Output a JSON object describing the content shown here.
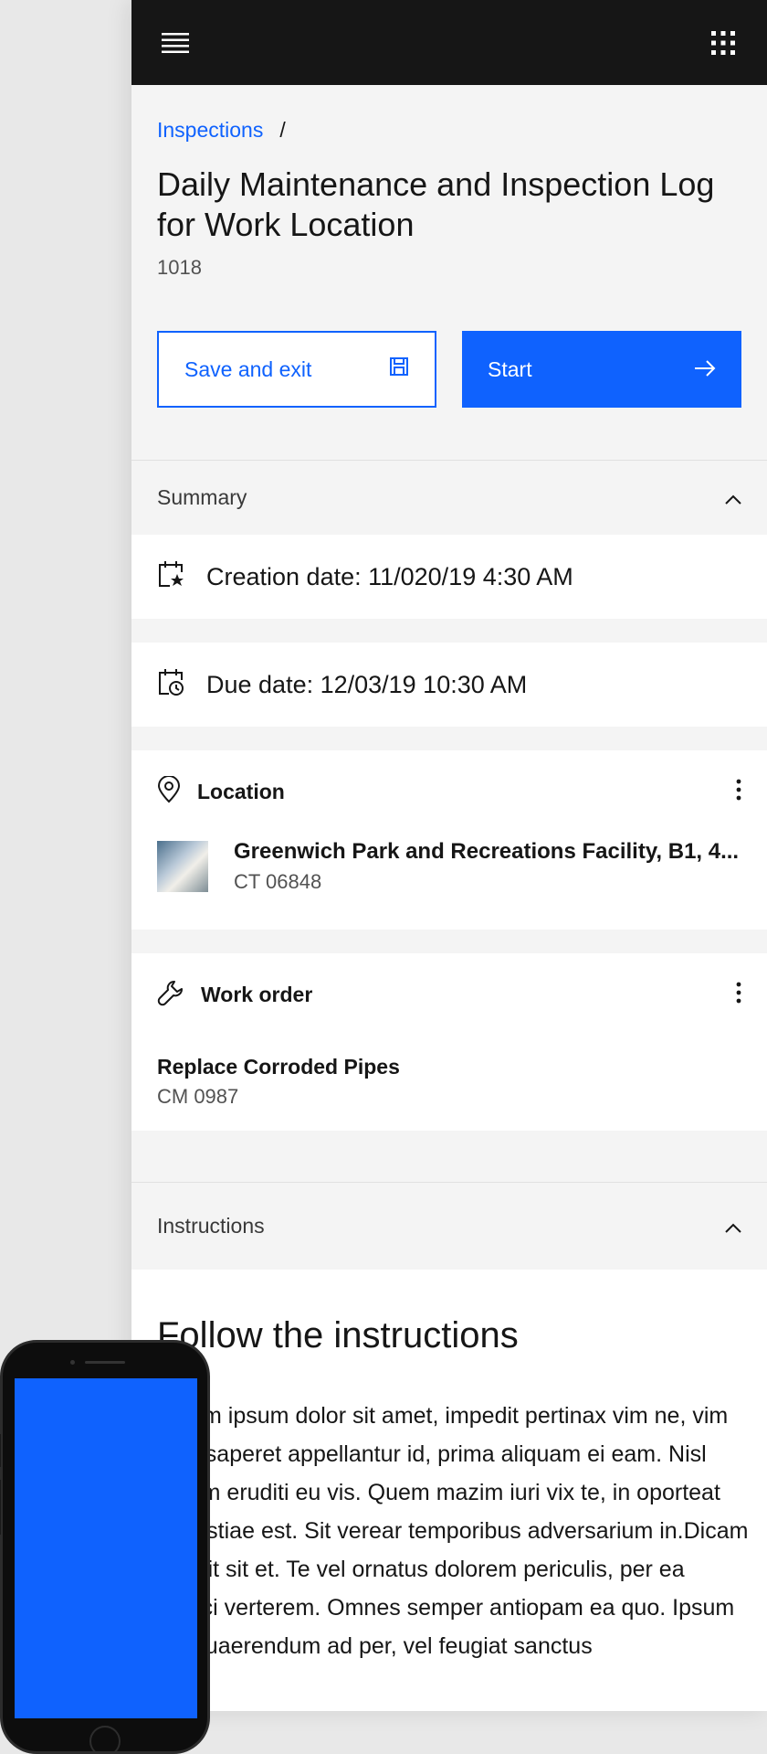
{
  "breadcrumb": {
    "link": "Inspections",
    "separator": "/"
  },
  "page": {
    "title": "Daily Maintenance and Inspection Log for Work Location",
    "subtitle": "1018"
  },
  "actions": {
    "save_label": "Save and exit",
    "start_label": "Start"
  },
  "summary": {
    "label": "Summary",
    "creation": "Creation date: 11/020/19  4:30 AM",
    "due": "Due date: 12/03/19  10:30 AM"
  },
  "location": {
    "label": "Location",
    "name": "Greenwich Park and Recreations Facility, B1, 4...",
    "sub": "CT 06848"
  },
  "work_order": {
    "label": "Work order",
    "name": "Replace Corroded Pipes",
    "sub": "CM 0987"
  },
  "instructions": {
    "label": "Instructions",
    "title": "Follow the instructions",
    "text": "Lorem ipsum dolor sit amet, impedit pertinax vim ne, vim dico saperet appellantur id, prima aliquam ei eam. Nisl natum eruditi eu vis. Quem mazim iuri vix te, in oporteat molestiae est. Sit verear temporibus adversarium in.Dicam eripuit sit et. Te vel ornatus dolorem periculis, per ea exerci verterem. Omnes semper antiopam ea quo. Ipsum vel quaerendum ad per, vel feugiat sanctus"
  },
  "colors": {
    "primary": "#0f62fe",
    "topbar": "#161616",
    "background": "#f4f4f4"
  }
}
